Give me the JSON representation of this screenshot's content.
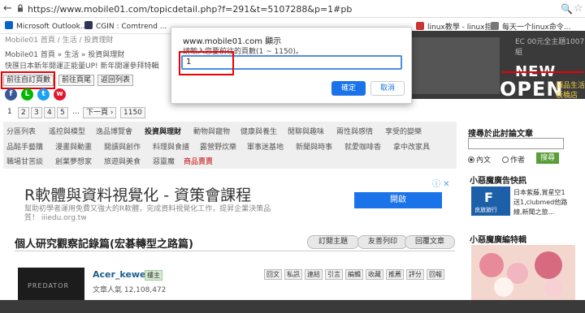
{
  "browser": {
    "url": "https://www.mobile01.com/topicdetail.php?f=291&t=5107288&p=1#pb",
    "bookmarks": [
      {
        "label": "Microsoft Outlook...",
        "icon": "outlook-icon",
        "color": "#0a64c8"
      },
      {
        "label": "CGIN : Comtrend ...",
        "icon": "cgin-icon",
        "color": "#335"
      },
      {
        "label": "linux教學 - linux指...",
        "icon": "linux-icon",
        "color": "#c33"
      },
      {
        "label": "每天一个linux命令...",
        "icon": "linux-cmd-icon",
        "color": "#777"
      }
    ]
  },
  "page": {
    "crumb_top": "Mobile01 首頁 / 生活 / 投資理財",
    "crumb": "Mobile01 首頁 » 生活 » 投資與理財",
    "promo": "快匯日本新年開運正能量UP! 新年開運參拜特輯",
    "nav": {
      "goto_page": "前往自訂頁數",
      "prev_page": "前往頁尾",
      "back_list": "返回列表"
    },
    "pagination": [
      "1",
      "2",
      "3",
      "4",
      "5",
      "…",
      "下一頁 ›",
      "1150"
    ],
    "categories": {
      "row1": [
        "分區列表",
        "遙控與模型",
        "逸品博覽會",
        "投資與理財",
        "動物與寵物",
        "健康與養生",
        "閒聊與趣味",
        "兩性與感情",
        "享受的變樂"
      ],
      "row2": [
        "品酩手藝購",
        "漫畫與動畫",
        "閱讀與創作",
        "料理與食譜",
        "露營野炊樂",
        "軍事迷基地",
        "新聞與時事",
        "就愛咖啡香",
        "拿中改家具"
      ],
      "row3": [
        "職場甘苦談",
        "創業夢想家",
        "旅遊與美食",
        "惡靈魔",
        "商品賣賣"
      ]
    },
    "ad": {
      "title": "R軟體與資料視覺化 - 資策會課程",
      "desc": "幫助初學者運用免費又強大的R軟體，完成資料視覺化工作，提昇企業決策品",
      "url": "質！ iiiedu.org.tw",
      "button": "開啟",
      "mark": "ⓘ ✕"
    },
    "topic": {
      "title": "個人研究觀察記錄篇(宏碁轉型之路篇)",
      "buttons": [
        "訂閱主題",
        "友善列印",
        "回覆文章"
      ]
    },
    "post": {
      "avatar_text": "PREDATOR",
      "username": "Acer_kewei",
      "badge": "樓主",
      "stat": "文章人氣 12,108,472",
      "actions": [
        "回文",
        "私訊",
        "連結",
        "引言",
        "編輯",
        "收藏",
        "推薦",
        "評分",
        "回報"
      ]
    }
  },
  "sidebar": {
    "banner": {
      "corner": "EC 00元全主題1007組",
      "new": "NEW",
      "open": "OPEN",
      "sub1": "讀品生活",
      "sub2": "板橋店"
    },
    "search": {
      "title": "搜尋於此討論文章",
      "option_content": "內文",
      "option_author": "作者",
      "button": "搜尋"
    },
    "ads": {
      "title": "小惡魔廣告快訊",
      "img_label": "良旅旅行",
      "lines": [
        "日本紫藤,賞星空1",
        "送1,clubmed他路",
        "線,新聞之旅..."
      ]
    },
    "hot_title": "小惡魔廣編特輯"
  },
  "dialog": {
    "title": "www.mobile01.com 顯示",
    "message": "請輸入您要前往的頁數(1 ~ 1150)。",
    "input_value": "1",
    "ok": "確定",
    "cancel": "取消"
  }
}
